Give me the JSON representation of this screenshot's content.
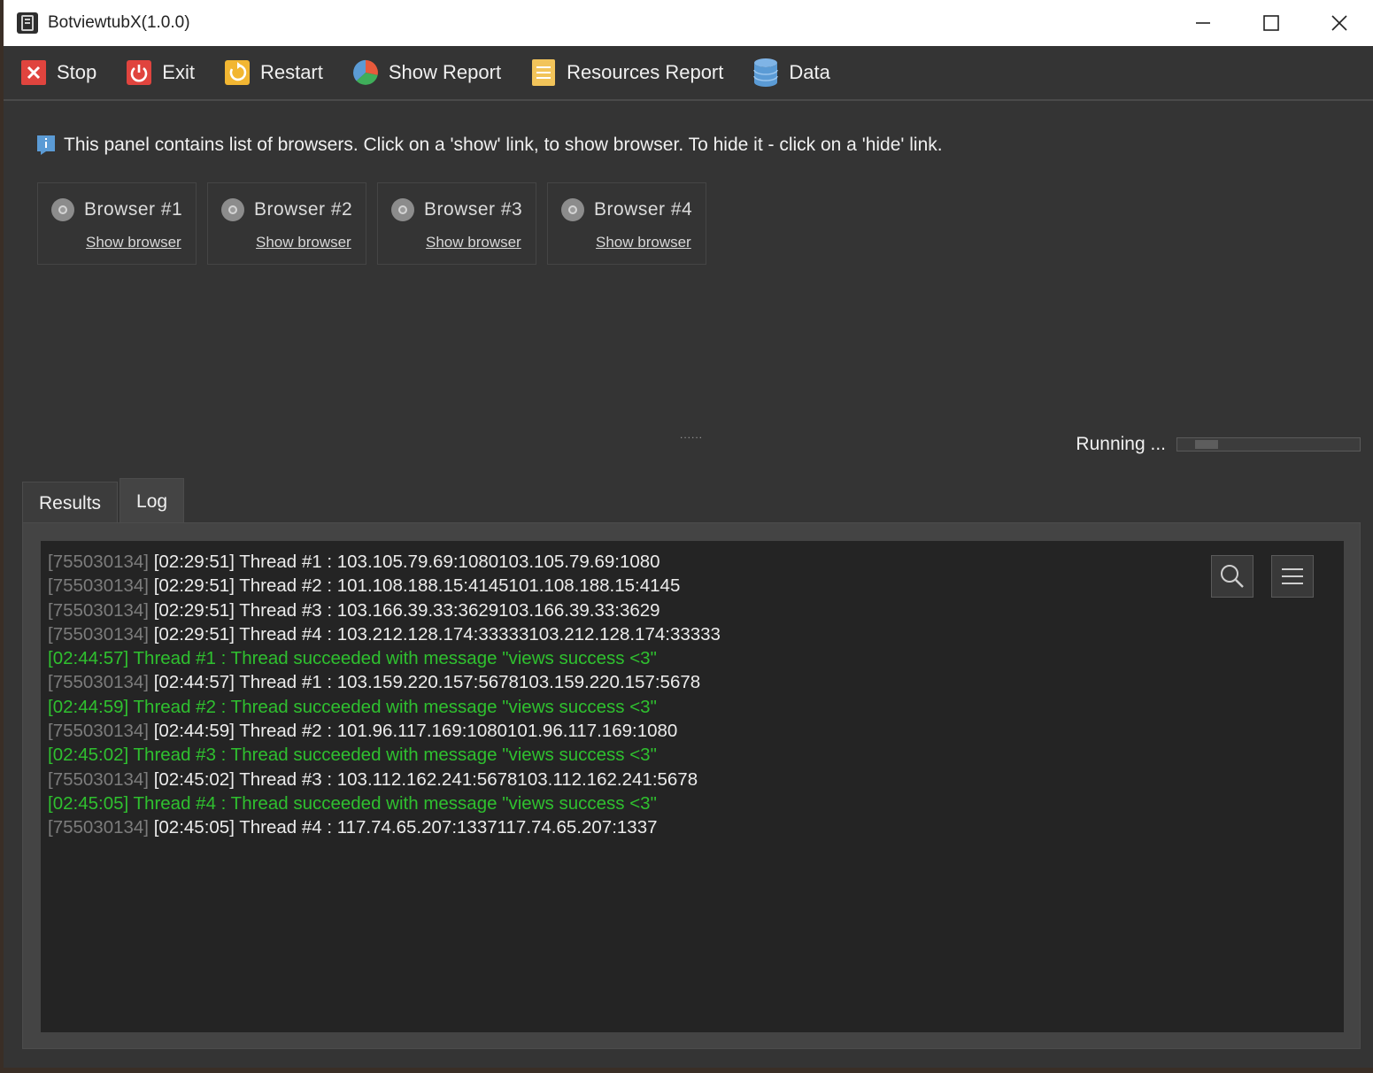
{
  "window": {
    "title": "BotviewtubX(1.0.0)",
    "controls": [
      "minimize-icon",
      "maximize-icon",
      "close-icon"
    ]
  },
  "toolbar": {
    "items": [
      {
        "label": "Stop",
        "icon": "stop-icon",
        "color": "#e0443e"
      },
      {
        "label": "Exit",
        "icon": "power-icon",
        "color": "#e0443e"
      },
      {
        "label": "Restart",
        "icon": "restart-icon",
        "color": "#f2b632"
      },
      {
        "label": "Show Report",
        "icon": "pie-chart-icon",
        "color": "#e85a3c"
      },
      {
        "label": "Resources Report",
        "icon": "document-icon",
        "color": "#f2c45a"
      },
      {
        "label": "Data",
        "icon": "database-icon",
        "color": "#5b9bd5"
      }
    ]
  },
  "info_text": "This panel contains list of browsers. Click on a 'show' link, to show browser. To hide it - click on a 'hide' link.",
  "browsers": [
    {
      "name": "Browser #1",
      "link": "Show browser"
    },
    {
      "name": "Browser #2",
      "link": "Show browser"
    },
    {
      "name": "Browser #3",
      "link": "Show browser"
    },
    {
      "name": "Browser #4",
      "link": "Show browser"
    }
  ],
  "splitter_text": "......",
  "status": {
    "text": "Running ..."
  },
  "tabs": [
    {
      "label": "Results",
      "active": false
    },
    {
      "label": "Log",
      "active": true
    }
  ],
  "log": {
    "lines": [
      {
        "prefix": "[755030134] ",
        "text": "[02:29:51] Thread #1 : 103.105.79.69:1080103.105.79.69:1080",
        "success": false
      },
      {
        "prefix": "[755030134] ",
        "text": "[02:29:51] Thread #2 : 101.108.188.15:4145101.108.188.15:4145",
        "success": false
      },
      {
        "prefix": "[755030134] ",
        "text": "[02:29:51] Thread #3 : 103.166.39.33:3629103.166.39.33:3629",
        "success": false
      },
      {
        "prefix": "[755030134] ",
        "text": "[02:29:51] Thread #4 : 103.212.128.174:33333103.212.128.174:33333",
        "success": false
      },
      {
        "prefix": "",
        "text": "[02:44:57] Thread #1 : Thread succeeded with message \"views success <3\"",
        "success": true
      },
      {
        "prefix": "[755030134] ",
        "text": "[02:44:57] Thread #1 : 103.159.220.157:5678103.159.220.157:5678",
        "success": false
      },
      {
        "prefix": "",
        "text": "[02:44:59] Thread #2 : Thread succeeded with message \"views success <3\"",
        "success": true
      },
      {
        "prefix": "[755030134] ",
        "text": "[02:44:59] Thread #2 : 101.96.117.169:1080101.96.117.169:1080",
        "success": false
      },
      {
        "prefix": "",
        "text": "[02:45:02] Thread #3 : Thread succeeded with message \"views success <3\"",
        "success": true
      },
      {
        "prefix": "[755030134] ",
        "text": "[02:45:02] Thread #3 : 103.112.162.241:5678103.112.162.241:5678",
        "success": false
      },
      {
        "prefix": "",
        "text": "[02:45:05] Thread #4 : Thread succeeded with message \"views success <3\"",
        "success": true
      },
      {
        "prefix": "[755030134] ",
        "text": "[02:45:05] Thread #4 : 117.74.65.207:1337117.74.65.207:1337",
        "success": false
      }
    ],
    "tools": [
      "search-icon",
      "menu-icon"
    ]
  }
}
